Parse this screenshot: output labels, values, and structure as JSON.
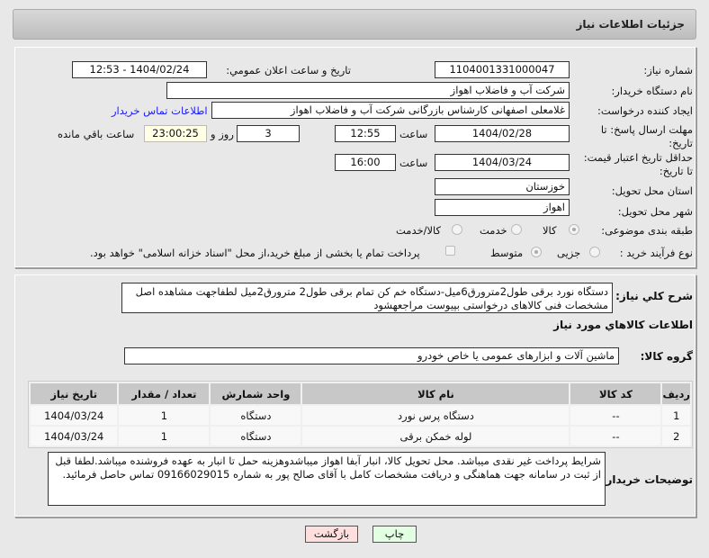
{
  "header": {
    "title": "جزئیات اطلاعات نیاز"
  },
  "form": {
    "need_number_label": "شماره نیاز:",
    "need_number": "1104001331000047",
    "announce_label": "تاریخ و ساعت اعلان عمومي:",
    "announce_value": "1404/02/24 - 12:53",
    "buyer_org_label": "نام دستگاه خریدار:",
    "buyer_org": "شرکت آب و فاضلاب اهواز",
    "creator_label": "ایجاد کننده درخواست:",
    "creator": "غلامعلی اصفهانی کارشناس بازرگانی شرکت آب و فاضلاب اهواز",
    "contact_link": "اطلاعات تماس خریدار",
    "deadline_label_1": "مهلت ارسال پاسخ: تا",
    "deadline_label_2": "تاریخ:",
    "deadline_date": "1404/02/28",
    "time_label": "ساعت",
    "deadline_time": "12:55",
    "days": "3",
    "days_label": "روز و",
    "remaining": "23:00:25",
    "remaining_label": "ساعت باقي مانده",
    "validity_label_1": "حداقل تاریخ اعتبار قیمت:",
    "validity_label_2": "تا تاریخ:",
    "validity_date": "1404/03/24",
    "validity_time": "16:00",
    "province_label": "استان محل تحویل:",
    "province": "خوزستان",
    "city_label": "شهر محل تحویل:",
    "city": "اهواز",
    "category_label": "طبقه بندی موضوعی:",
    "category_options": [
      "کالا",
      "خدمت",
      "کالا/خدمت"
    ],
    "category_selected": "کالا",
    "process_label": "نوع فرآیند خرید :",
    "process_options": [
      "جزیی",
      "متوسط"
    ],
    "treasury_text": "پرداخت تمام یا بخشی از مبلغ خرید،از محل \"اسناد خزانه اسلامی\" خواهد بود."
  },
  "details": {
    "desc_label": "شرح کلي نیاز:",
    "desc": "دستگاه نورد برقی طول2مترورق6میل-دستگاه خم کن تمام برقی طول2 مترورق2میل لطفاجهت مشاهده اصل مشخصات فنی کالاهای درخواستی بپیوست مراجعهشود",
    "goods_title": "اطلاعات کالاهاي مورد نیاز",
    "group_label": "گروه کالا:",
    "group": "ماشین آلات و ابزارهای عمومی یا خاص خودرو",
    "table": {
      "headers": [
        "ردیف",
        "کد کالا",
        "نام کالا",
        "واحد شمارش",
        "تعداد / مقدار",
        "تاریخ نیاز"
      ],
      "rows": [
        [
          "1",
          "--",
          "دستگاه پرس نورد",
          "دستگاه",
          "1",
          "1404/03/24"
        ],
        [
          "2",
          "--",
          "لوله خمکن برقی",
          "دستگاه",
          "1",
          "1404/03/24"
        ]
      ]
    },
    "notes_label": "توضیحات خریدار:",
    "notes": "شرایط پرداخت غیر نقدی میباشد. محل تحویل کالا، انبار آبفا اهواز میباشدوهزینه حمل تا انبار به عهده فروشنده میباشد.لطفا قبل از ثبت در سامانه جهت هماهنگی و دریافت مشخصات کامل با آقای  صالح پور به شماره 09166029015 تماس حاصل فرمائید."
  },
  "buttons": {
    "back": "بازگشت",
    "print": "چاپ"
  },
  "colors": {
    "link": "#1a1aff",
    "back_bg": "#ffdede",
    "print_bg": "#e2ffe2",
    "remaining_bg": "#ffffe6"
  }
}
